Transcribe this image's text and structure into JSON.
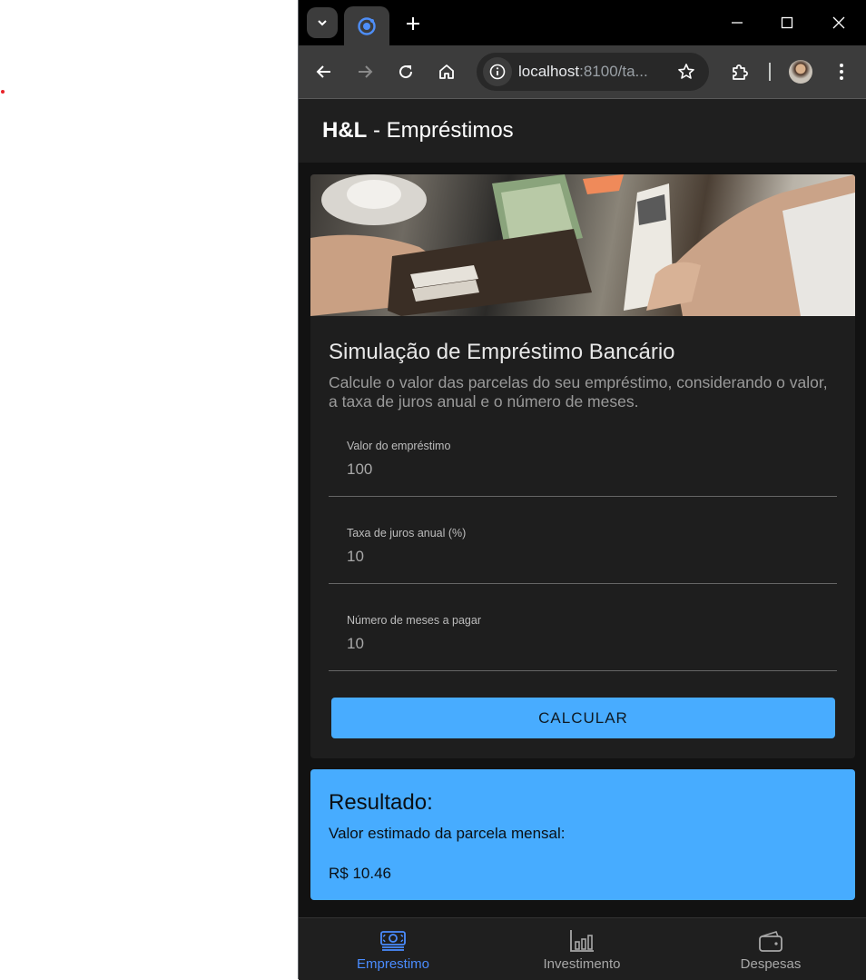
{
  "browser": {
    "url_host": "localhost",
    "url_rest": ":8100/ta...",
    "accent": "#3c8cff"
  },
  "app": {
    "title_bold": "H&L",
    "title_rest": " - Empréstimos"
  },
  "card": {
    "title": "Simulação de Empréstimo Bancário",
    "subtitle": "Calcule o valor das parcelas do seu empréstimo, considerando o valor, a taxa de juros anual e o número de meses.",
    "fields": [
      {
        "label": "Valor do empréstimo",
        "value": "100"
      },
      {
        "label": "Taxa de juros anual (%)",
        "value": "10"
      },
      {
        "label": "Número de meses a pagar",
        "value": "10"
      }
    ],
    "button_label": "CALCULAR",
    "button_color": "#48acff"
  },
  "result": {
    "title": "Resultado:",
    "label": "Valor estimado da parcela mensal:",
    "value": "R$ 10.46",
    "color": "#47acff"
  },
  "tabs": [
    {
      "label": "Emprestimo",
      "icon": "cash-icon",
      "active": true
    },
    {
      "label": "Investimento",
      "icon": "bar-chart-icon",
      "active": false
    },
    {
      "label": "Despesas",
      "icon": "wallet-icon",
      "active": false
    }
  ]
}
